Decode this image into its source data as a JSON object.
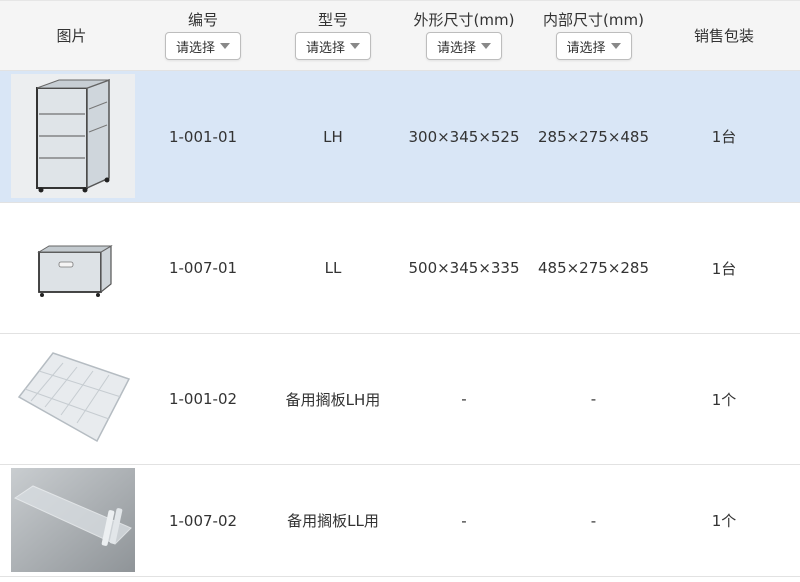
{
  "header": {
    "image_label": "图片",
    "code_label": "编号",
    "model_label": "型号",
    "outer_label": "外形尺寸(mm)",
    "inner_label": "内部尺寸(mm)",
    "pack_label": "销售包装",
    "select_placeholder": "请选择"
  },
  "rows": [
    {
      "code": "1-001-01",
      "model": "LH",
      "outer": "300×345×525",
      "inner": "285×275×485",
      "pack": "1台",
      "selected": true
    },
    {
      "code": "1-007-01",
      "model": "LL",
      "outer": "500×345×335",
      "inner": "485×275×285",
      "pack": "1台",
      "selected": false
    },
    {
      "code": "1-001-02",
      "model": "备用搁板LH用",
      "outer": "-",
      "inner": "-",
      "pack": "1个",
      "selected": false
    },
    {
      "code": "1-007-02",
      "model": "备用搁板LL用",
      "outer": "-",
      "inner": "-",
      "pack": "1个",
      "selected": false
    }
  ]
}
